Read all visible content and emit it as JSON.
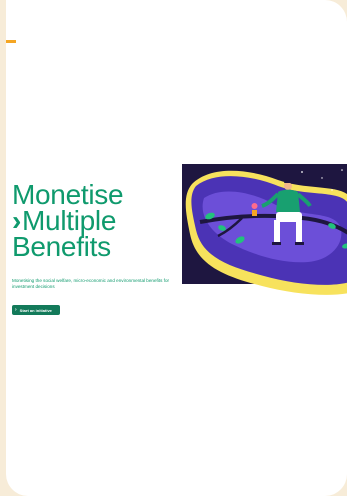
{
  "hero": {
    "title_line1": "Monetise",
    "title_line2": "Multiple",
    "title_line3": "Benefits",
    "title_marker_icon": "chevron-right-icon",
    "subtitle": "Monetising the social welfare, micro-economic and environmental benefits for investment decisions"
  },
  "cta": {
    "label": "Start an initiative",
    "icon": "chevron-right-icon"
  },
  "illustration": {
    "description_icon": "person-sitting-on-tree-illustration"
  },
  "colors": {
    "brand_green": "#0f9a6d",
    "button_green": "#137a5a",
    "accent_orange": "#f5a623",
    "page_background": "#f7ecd8",
    "illustration_purple": "#4b33b5",
    "illustration_yellow": "#f7e25d"
  }
}
